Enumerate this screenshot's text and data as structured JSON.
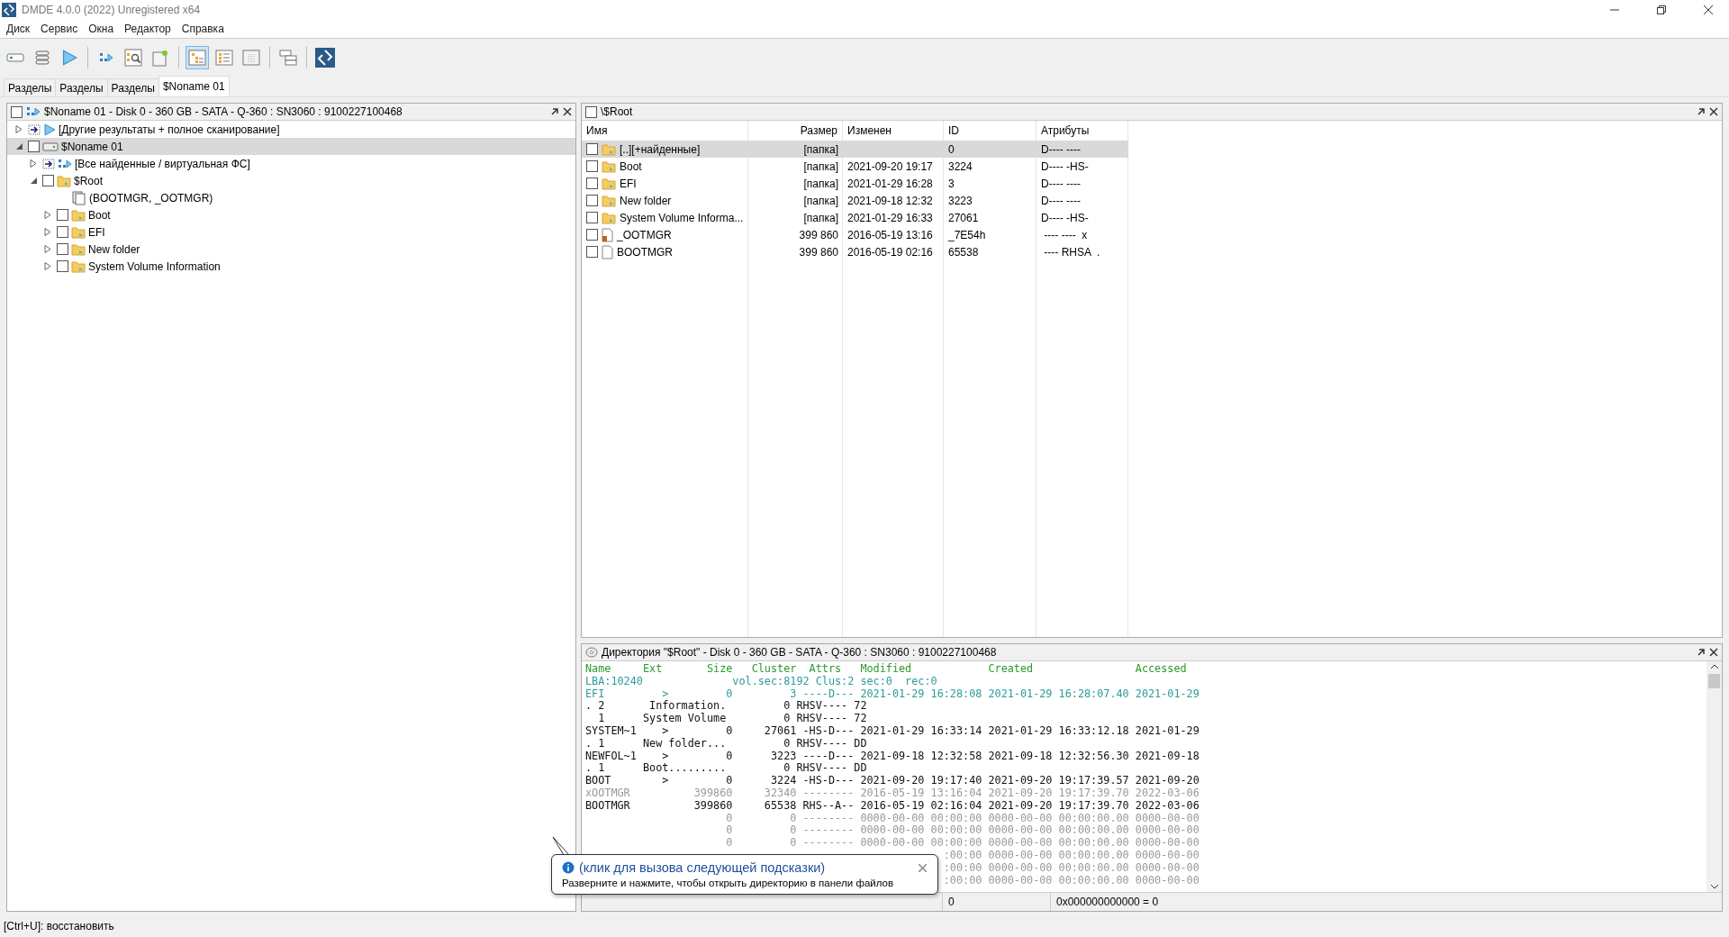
{
  "window": {
    "title": "DMDE 4.0.0 (2022) Unregistered x64"
  },
  "menu": [
    "Диск",
    "Сервис",
    "Окна",
    "Редактор",
    "Справка"
  ],
  "toolbar": [
    {
      "kind": "drive",
      "selected": false
    },
    {
      "kind": "stack",
      "selected": false
    },
    {
      "kind": "play",
      "selected": false
    },
    {
      "kind": "sep"
    },
    {
      "kind": "flow",
      "selected": false
    },
    {
      "kind": "search",
      "selected": false
    },
    {
      "kind": "new",
      "selected": false
    },
    {
      "kind": "sep"
    },
    {
      "kind": "tree",
      "selected": true
    },
    {
      "kind": "list",
      "selected": false
    },
    {
      "kind": "grid",
      "selected": false
    },
    {
      "kind": "sep"
    },
    {
      "kind": "split",
      "selected": false
    },
    {
      "kind": "sep"
    },
    {
      "kind": "logo",
      "selected": false
    }
  ],
  "tabs": [
    {
      "label": "Разделы",
      "selected": false
    },
    {
      "label": "Разделы",
      "selected": false
    },
    {
      "label": "Разделы",
      "selected": false
    },
    {
      "label": "$Noname 01",
      "selected": true
    }
  ],
  "tree_panel": {
    "title": "$Noname 01 - Disk 0 - 360 GB - SATA - Q-360 : SN3060 : 9100227100468",
    "checked": false,
    "items": [
      {
        "label": "[Другие результаты + полное сканирование]",
        "kind": "scan",
        "expanded": false,
        "selected": false
      },
      {
        "label": "$Noname 01",
        "kind": "volume",
        "expanded": true,
        "checked": false,
        "selected": true,
        "children": [
          {
            "label": "[Все найденные / виртуальная ФС]",
            "kind": "virtual",
            "expanded": false,
            "selected": false
          },
          {
            "label": "$Root",
            "kind": "folder",
            "expanded": true,
            "checked": false,
            "selected": false,
            "children": [
              {
                "label": "(BOOTMGR, _OOTMGR)",
                "kind": "files",
                "selected": false
              },
              {
                "label": "Boot",
                "kind": "folder",
                "expanded": false,
                "checked": false,
                "selected": false
              },
              {
                "label": "EFI",
                "kind": "folder",
                "expanded": false,
                "checked": false,
                "selected": false
              },
              {
                "label": "New folder",
                "kind": "folder",
                "expanded": false,
                "checked": false,
                "selected": false
              },
              {
                "label": "System Volume Information",
                "kind": "folder",
                "expanded": false,
                "checked": false,
                "selected": false
              }
            ]
          }
        ]
      }
    ]
  },
  "files_panel": {
    "title": "\\$Root",
    "checked": false,
    "columns": [
      "Имя",
      "Размер",
      "Изменен",
      "ID",
      "Атрибуты"
    ],
    "rows": [
      {
        "kind": "folder",
        "name": "[..][+найденные]",
        "size": "[папка]",
        "modified": "",
        "id": "0",
        "attrs": "D---- ----",
        "checked": false,
        "selected": true
      },
      {
        "kind": "folder",
        "name": "Boot",
        "size": "[папка]",
        "modified": "2021-09-20 19:17",
        "id": "3224",
        "attrs": "D---- -HS-",
        "checked": false,
        "selected": false
      },
      {
        "kind": "folder",
        "name": "EFI",
        "size": "[папка]",
        "modified": "2021-01-29 16:28",
        "id": "3",
        "attrs": "D---- ----",
        "checked": false,
        "selected": false
      },
      {
        "kind": "folder",
        "name": "New folder",
        "size": "[папка]",
        "modified": "2021-09-18 12:32",
        "id": "3223",
        "attrs": "D---- ----",
        "checked": false,
        "selected": false
      },
      {
        "kind": "folder",
        "name": "System Volume Informa...",
        "size": "[папка]",
        "modified": "2021-01-29 16:33",
        "id": "27061",
        "attrs": "D---- -HS-",
        "checked": false,
        "selected": false
      },
      {
        "kind": "deleted",
        "name": "_OOTMGR",
        "size": "399 860",
        "modified": "2016-05-19 13:16",
        "id": "_7E54h",
        "attrs": " ---- ----  x",
        "checked": false,
        "selected": false
      },
      {
        "kind": "file",
        "name": "BOOTMGR",
        "size": "399 860",
        "modified": "2016-05-19 02:16",
        "id": "65538",
        "attrs": " ---- RHSA  .",
        "checked": false,
        "selected": false
      }
    ]
  },
  "directory_panel": {
    "title": "Директория \"$Root\" - Disk 0 - 360 GB - SATA - Q-360 : SN3060 : 9100227100468",
    "lines": [
      {
        "kind": "header",
        "text": "Name     Ext       Size   Cluster  Attrs   Modified            Created                Accessed"
      },
      {
        "kind": "info",
        "text": "LBA:10240              vol.sec:8192 Clus:2 sec:0  rec:0"
      },
      {
        "kind": "current",
        "text": "EFI         >         0         3 ----D--- 2021-01-29 16:28:08 2021-01-29 16:28:07.40 2021-01-29"
      },
      {
        "kind": "normal",
        "text": ". 2       Information.         0 RHSV---- 72"
      },
      {
        "kind": "normal",
        "text": "  1      System Volume         0 RHSV---- 72"
      },
      {
        "kind": "normal",
        "text": "SYSTEM~1    >         0     27061 -HS-D--- 2021-01-29 16:33:14 2021-01-29 16:33:12.18 2021-01-29"
      },
      {
        "kind": "normal",
        "text": ". 1      New folder...         0 RHSV---- DD"
      },
      {
        "kind": "normal",
        "text": "NEWFOL~1    >         0      3223 ----D--- 2021-09-18 12:32:58 2021-09-18 12:32:56.30 2021-09-18"
      },
      {
        "kind": "normal",
        "text": ". 1      Boot.........         0 RHSV---- DD"
      },
      {
        "kind": "normal",
        "text": "BOOT        >         0      3224 -HS-D--- 2021-09-20 19:17:40 2021-09-20 19:17:39.57 2021-09-20"
      },
      {
        "kind": "deleted",
        "text": "xOOTMGR          399860     32340 -------- 2016-05-19 13:16:04 2021-09-20 19:17:39.70 2022-03-06"
      },
      {
        "kind": "normal",
        "text": "BOOTMGR          399860     65538 RHS--A-- 2016-05-19 02:16:04 2021-09-20 19:17:39.70 2022-03-06"
      },
      {
        "kind": "empty",
        "text": "                      0         0 -------- 0000-00-00 00:00:00 0000-00-00 00:00:00.00 0000-00-00"
      },
      {
        "kind": "empty",
        "text": "                      0         0 -------- 0000-00-00 00:00:00 0000-00-00 00:00:00.00 0000-00-00"
      },
      {
        "kind": "empty",
        "text": "                      0         0 -------- 0000-00-00 00:00:00 0000-00-00 00:00:00.00 0000-00-00"
      },
      {
        "kind": "partial",
        "text": ":00:00 0000-00-00 00:00:00.00 0000-00-00"
      },
      {
        "kind": "partial",
        "text": ":00:00 0000-00-00 00:00:00.00 0000-00-00"
      },
      {
        "kind": "partial",
        "text": ":00:00 0000-00-00 00:00:00.00 0000-00-00"
      }
    ],
    "footer": [
      "0",
      "0x000000000000 = 0"
    ]
  },
  "tooltip": {
    "title": "(клик для вызова следующей подсказки)",
    "text": "Разверните и нажмите, чтобы открыть директорию в панели файлов"
  },
  "status_bar": "[Ctrl+U]: восстановить"
}
